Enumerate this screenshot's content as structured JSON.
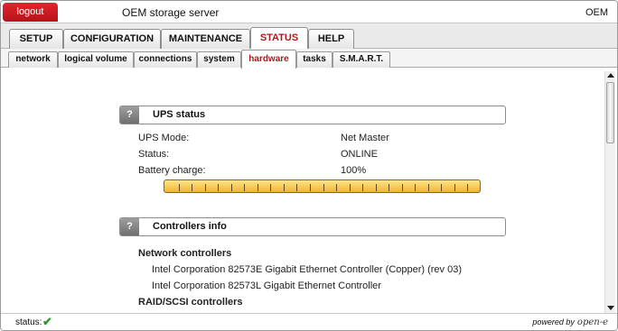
{
  "header": {
    "logout_label": "logout",
    "app_title": "OEM storage server",
    "brand": "OEM"
  },
  "main_tabs": [
    {
      "label": "SETUP",
      "active": false
    },
    {
      "label": "CONFIGURATION",
      "active": false
    },
    {
      "label": "MAINTENANCE",
      "active": false
    },
    {
      "label": "STATUS",
      "active": true
    },
    {
      "label": "HELP",
      "active": false
    }
  ],
  "sub_tabs": [
    {
      "label": "network",
      "active": false
    },
    {
      "label": "logical volume",
      "active": false
    },
    {
      "label": "connections",
      "active": false
    },
    {
      "label": "system",
      "active": false
    },
    {
      "label": "hardware",
      "active": true
    },
    {
      "label": "tasks",
      "active": false
    },
    {
      "label": "S.M.A.R.T.",
      "active": false
    }
  ],
  "ups": {
    "help_label": "?",
    "title": "UPS status",
    "rows": [
      {
        "label": "UPS Mode:",
        "value": "Net Master"
      },
      {
        "label": "Status:",
        "value": "ONLINE"
      },
      {
        "label": "Battery charge:",
        "value": "100%"
      }
    ],
    "battery_fraction": 1.0
  },
  "controllers": {
    "help_label": "?",
    "title": "Controllers info",
    "network_heading": "Network controllers",
    "network_items": [
      "Intel Corporation 82573E Gigabit Ethernet Controller (Copper) (rev 03)",
      "Intel Corporation 82573L Gigabit Ethernet Controller"
    ],
    "raid_heading": "RAID/SCSI controllers"
  },
  "statusbar": {
    "label": "status:",
    "check": "✔",
    "powered_by": "powered by",
    "powered_brand": "open-e"
  },
  "colors": {
    "accent": "#b3141b",
    "logout_bg": "#d01c23",
    "battery": "#f5c242",
    "ok": "#2e9a2e"
  }
}
